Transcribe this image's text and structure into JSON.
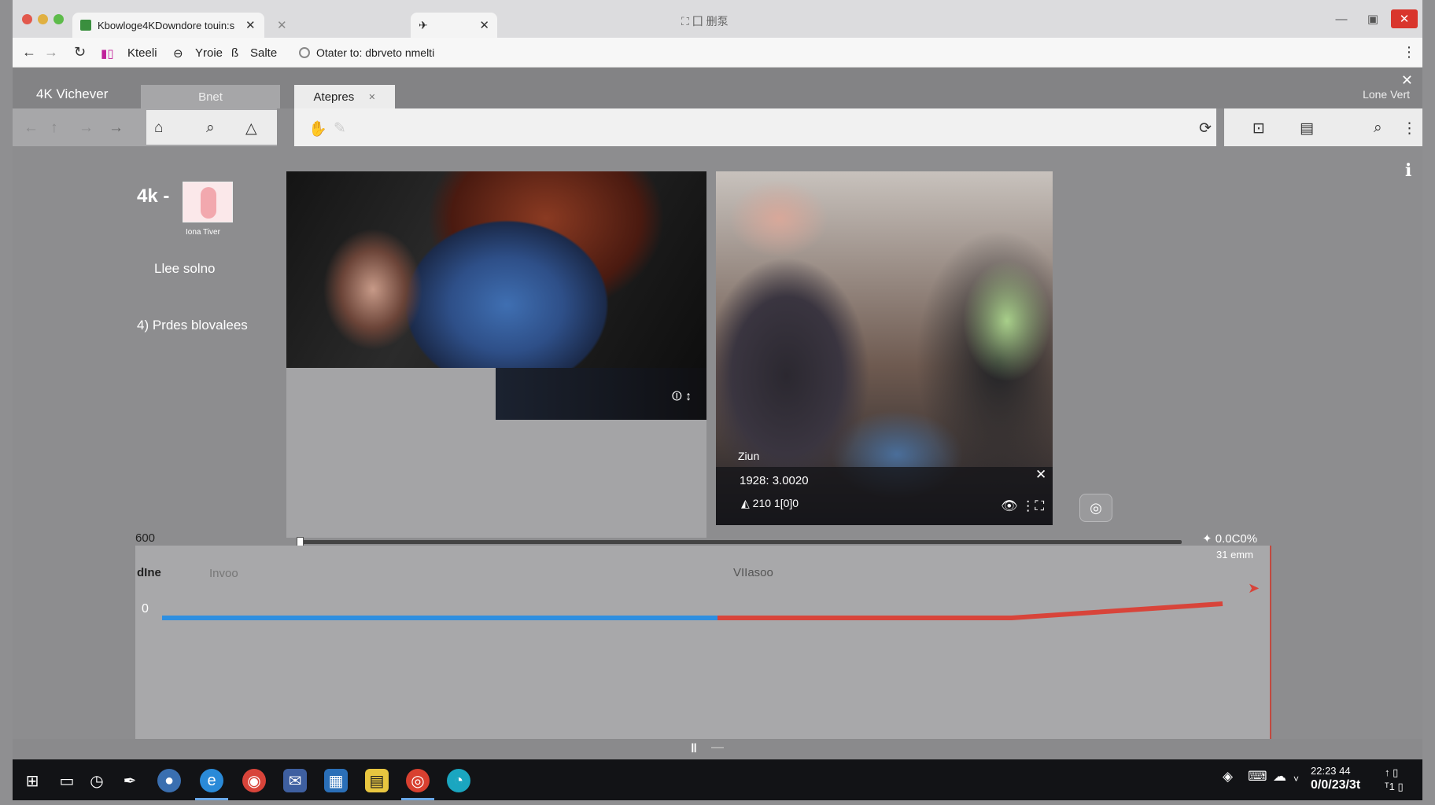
{
  "browser": {
    "tabs": [
      {
        "label": "Kbowloge4KDowndore touin:s",
        "active": true
      },
      {
        "label": "",
        "active": false
      },
      {
        "label": "",
        "active": true
      }
    ],
    "window_title": "⛶ 囗 删泵",
    "bookmarks": [
      "Kteeli",
      "Yroie",
      "Salte"
    ],
    "url": "Otater to: dbrveto nmelti"
  },
  "app": {
    "name": "4K Vichever",
    "tabs": [
      {
        "label": "Bnet"
      },
      {
        "label": "Atepres"
      }
    ],
    "top_right": "Lone  Vert"
  },
  "sidebar": {
    "brand": "4k -",
    "thumb_caption": "Iona Tiver",
    "items": [
      "Llee solno",
      "4) Prdes blovalees"
    ]
  },
  "player1": {
    "control": "⏼ ↕"
  },
  "player2": {
    "label": "Ziun",
    "time": "1928:  3.0020",
    "rate": "210 1[0]0",
    "controls": "👁  ⋮⛶"
  },
  "scrubber": {
    "left_label": "600",
    "right_label": "✦ 0.0C0%",
    "progress": 0.0
  },
  "timeline": {
    "label_main": "dIne",
    "label_sub": "Invoo",
    "label_center": "VIIasoo",
    "label_right": "31 emm",
    "zero_label": "0",
    "colors": {
      "before": "#2e8fe0",
      "after": "#d8443a"
    }
  },
  "taskbar": {
    "clock_time": "22:23  44",
    "clock_date": "0/0/23/3t",
    "tray_right": "↑ ▯",
    "tray_right2": "ᵀ1 ▯"
  }
}
